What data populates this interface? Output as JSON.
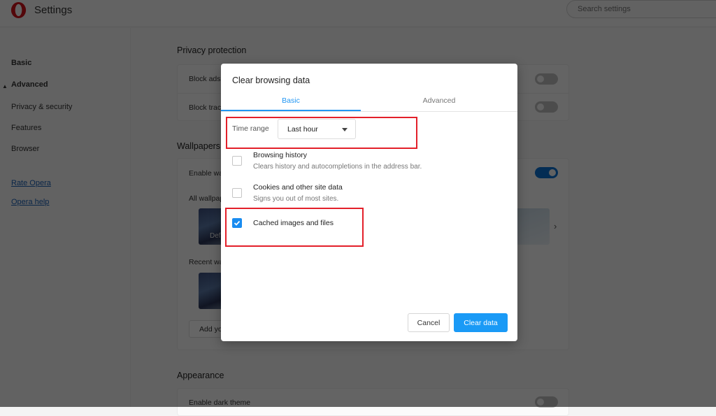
{
  "app": {
    "title": "Settings",
    "logo_icon": "opera-logo-icon"
  },
  "search": {
    "placeholder": "Search settings"
  },
  "sidebar": {
    "items": [
      {
        "label": "Basic",
        "style": "bold"
      },
      {
        "label": "Advanced",
        "style": "bold",
        "expanded": true
      },
      {
        "label": "Privacy & security"
      },
      {
        "label": "Features"
      },
      {
        "label": "Browser"
      }
    ],
    "links": [
      {
        "label": "Rate Opera"
      },
      {
        "label": "Opera help"
      }
    ]
  },
  "main": {
    "privacy": {
      "title": "Privacy protection",
      "rows": [
        {
          "label": "Block ads",
          "enabled": false
        },
        {
          "label": "Block trackers",
          "enabled": false
        }
      ]
    },
    "wallpapers": {
      "title": "Wallpapers",
      "enable_label": "Enable wallpapers",
      "enabled": true,
      "all_label": "All wallpapers",
      "default_caption": "Default",
      "recent_label": "Recent wallpapers",
      "add_label": "Add your wallpaper"
    },
    "appearance": {
      "title": "Appearance",
      "dark_theme_label": "Enable dark theme",
      "dark_theme_enabled": false
    }
  },
  "dialog": {
    "title": "Clear browsing data",
    "tabs": [
      {
        "label": "Basic",
        "active": true
      },
      {
        "label": "Advanced",
        "active": false
      }
    ],
    "time_range": {
      "label": "Time range",
      "value": "Last hour"
    },
    "options": [
      {
        "title": "Browsing history",
        "subtitle": "Clears history and autocompletions in the address bar.",
        "checked": false
      },
      {
        "title": "Cookies and other site data",
        "subtitle": "Signs you out of most sites.",
        "checked": false
      },
      {
        "title": "Cached images and files",
        "subtitle": "",
        "checked": true
      }
    ],
    "cancel_label": "Cancel",
    "clear_label": "Clear data"
  },
  "colors": {
    "accent": "#1a9af6",
    "highlight": "#e3202a",
    "toggle_on": "#0a72d1"
  }
}
